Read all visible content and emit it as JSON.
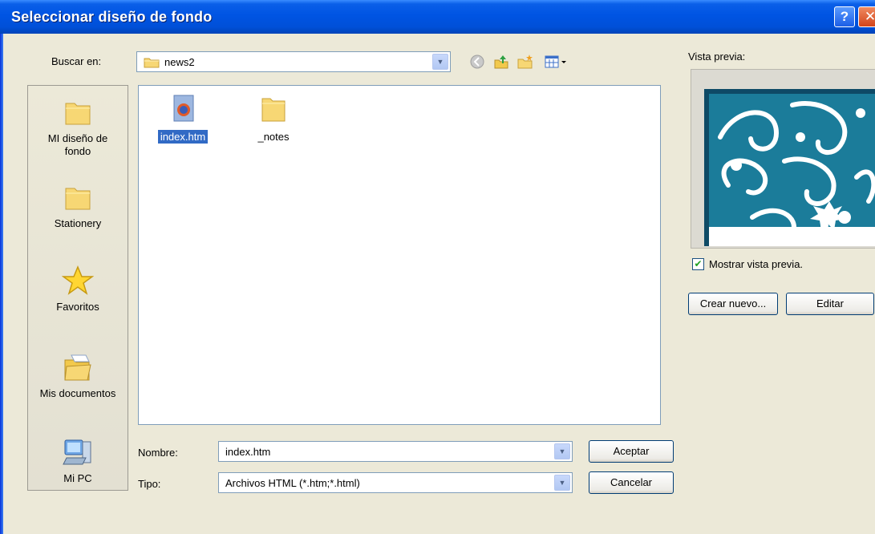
{
  "window": {
    "title": "Seleccionar diseño de fondo",
    "help_label": "?",
    "close_label": "✕"
  },
  "lookin": {
    "label": "Buscar en:",
    "value": "news2"
  },
  "toolbar": {
    "icons": [
      "back-icon",
      "up-folder-icon",
      "new-folder-icon",
      "view-menu-icon"
    ]
  },
  "places": [
    {
      "label": "MI diseño de fondo",
      "icon": "folder-icon"
    },
    {
      "label": "Stationery",
      "icon": "folder-icon"
    },
    {
      "label": "Favoritos",
      "icon": "star-icon"
    },
    {
      "label": "Mis documentos",
      "icon": "documents-folder-icon"
    },
    {
      "label": "Mi PC",
      "icon": "computer-icon"
    }
  ],
  "files": [
    {
      "name": "index.htm",
      "icon": "html-file-icon",
      "selected": true
    },
    {
      "name": "_notes",
      "icon": "folder-icon",
      "selected": false
    }
  ],
  "filename": {
    "label": "Nombre:",
    "value": "index.htm"
  },
  "filetype": {
    "label": "Tipo:",
    "value": "Archivos HTML (*.htm;*.html)"
  },
  "buttons": {
    "accept": "Aceptar",
    "cancel": "Cancelar",
    "create_new": "Crear nuevo...",
    "edit": "Editar"
  },
  "preview": {
    "label": "Vista previa:",
    "show_label": "Mostrar vista previa.",
    "show_checked": true
  },
  "colors": {
    "title_bar": "#0054e3",
    "selection": "#316ac5",
    "preview_teal": "#1b7c9a"
  }
}
